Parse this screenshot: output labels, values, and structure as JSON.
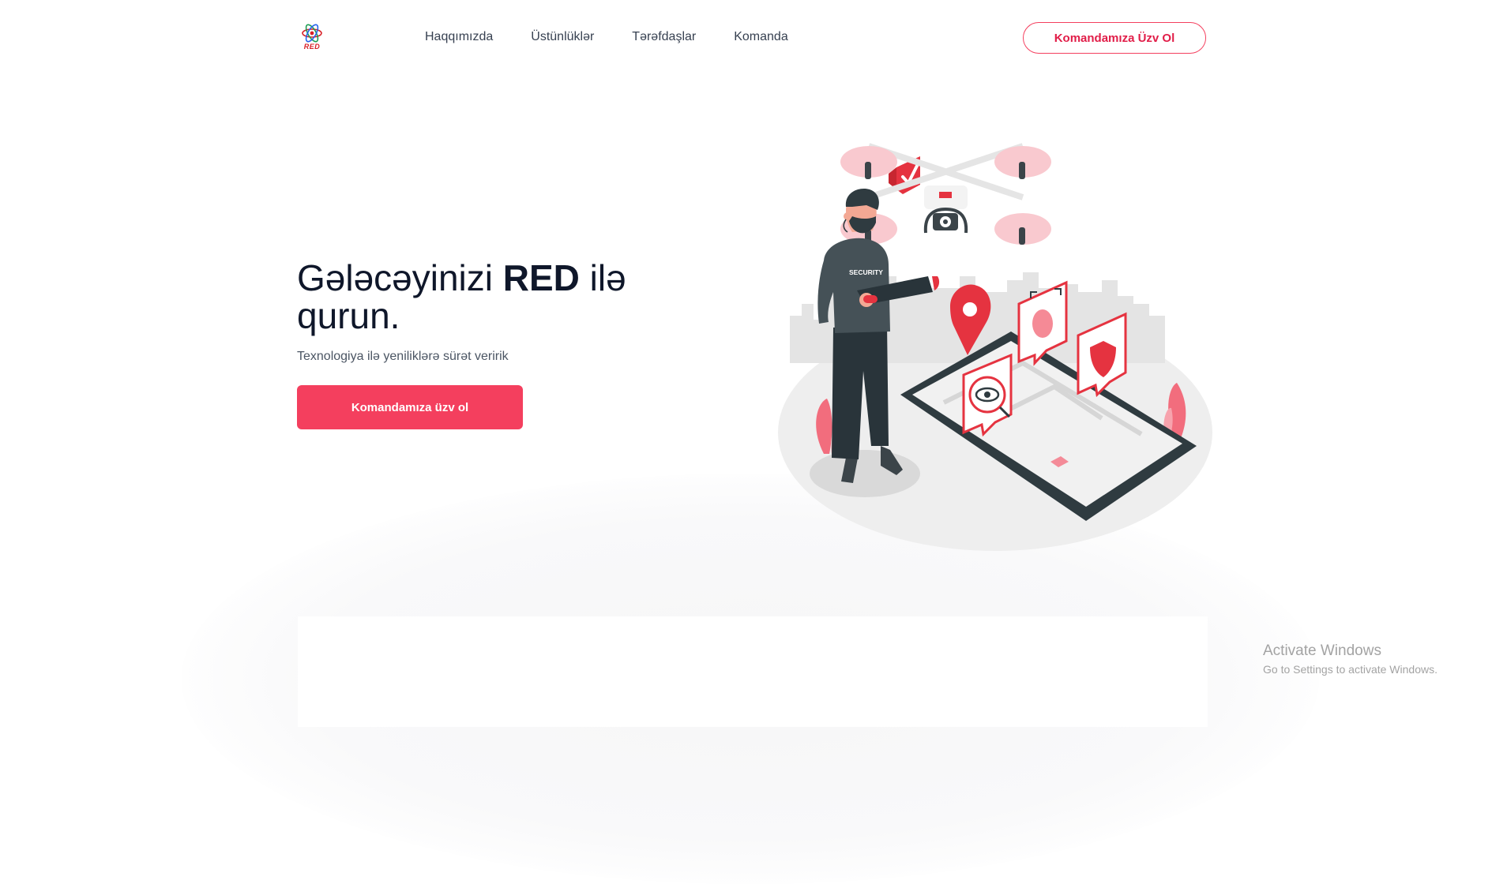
{
  "brand": {
    "logo_text": "RED",
    "accent": "#f43f5e"
  },
  "nav": {
    "items": [
      {
        "label": "Haqqımızda"
      },
      {
        "label": "Üstünlüklər"
      },
      {
        "label": "Tərəfdaşlar"
      },
      {
        "label": "Komanda"
      }
    ],
    "cta_label": "Komandamıza Üzv Ol"
  },
  "hero": {
    "title_part1": "Gələcəyinizi ",
    "title_brand": "RED",
    "title_part2": " ilə qurun.",
    "subtitle": "Texnologiya ilə yeniliklərə sürət veririk",
    "button_label": "Komandamıza üzv ol"
  },
  "illustration": {
    "badge_text": "SECURITY"
  },
  "windows_watermark": {
    "title": "Activate Windows",
    "subtitle": "Go to Settings to activate Windows."
  }
}
